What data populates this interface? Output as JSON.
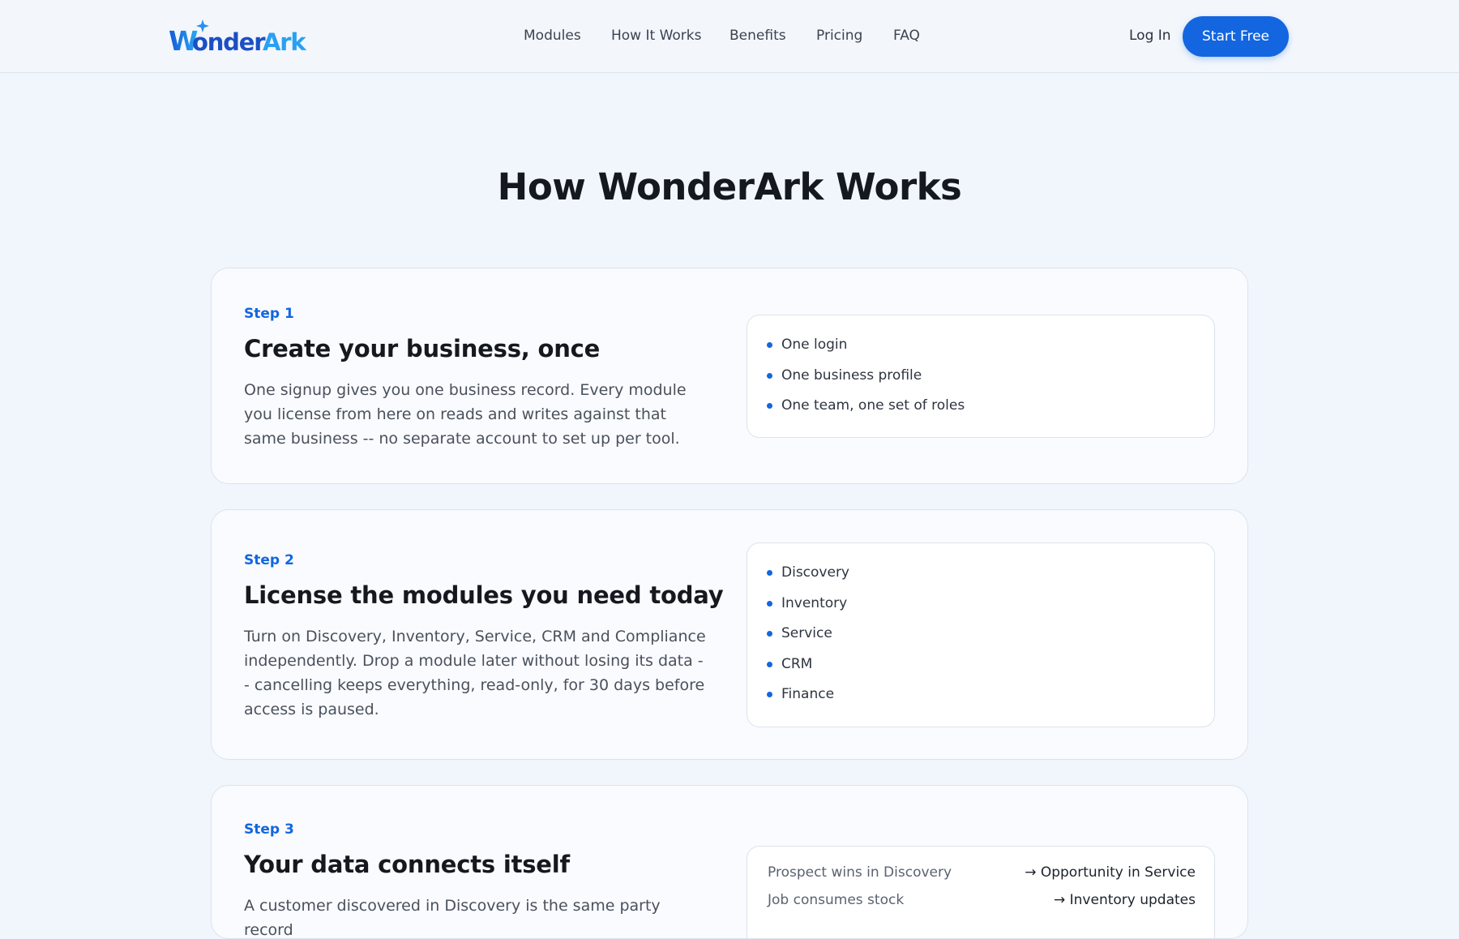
{
  "brand": {
    "name": "WonderArk",
    "logo_part1": "W",
    "logo_part2": "onder",
    "logo_part3": "Ark",
    "accent": "#1366e0",
    "accent_light": "#2aa8f5"
  },
  "nav": {
    "items": [
      {
        "label": "Modules"
      },
      {
        "label": "How It Works"
      },
      {
        "label": "Benefits"
      },
      {
        "label": "Pricing"
      },
      {
        "label": "FAQ"
      }
    ],
    "login_label": "Log In",
    "cta_label": "Start Free"
  },
  "page": {
    "title": "How WonderArk Works"
  },
  "steps": [
    {
      "label": "Step 1",
      "heading": "Create your business, once",
      "description": "One signup gives you one business record. Every module you license from here on reads and writes against that same business -- no separate account to set up per tool.",
      "bullets": [
        "One login",
        "One business profile",
        "One team, one set of roles"
      ]
    },
    {
      "label": "Step 2",
      "heading": "License the modules you need today",
      "description": "Turn on Discovery, Inventory, Service, CRM and Compliance independently. Drop a module later without losing its data -- cancelling keeps everything, read-only, for 30 days before access is paused.",
      "bullets": [
        "Discovery",
        "Inventory",
        "Service",
        "CRM",
        "Finance"
      ]
    },
    {
      "label": "Step 3",
      "heading": "Your data connects itself",
      "description": "A customer discovered in Discovery is the same party record",
      "flows": [
        {
          "from": "Prospect wins in Discovery",
          "to": "→ Opportunity in Service"
        },
        {
          "from": "Job consumes stock",
          "to": "→ Inventory updates"
        }
      ]
    }
  ]
}
